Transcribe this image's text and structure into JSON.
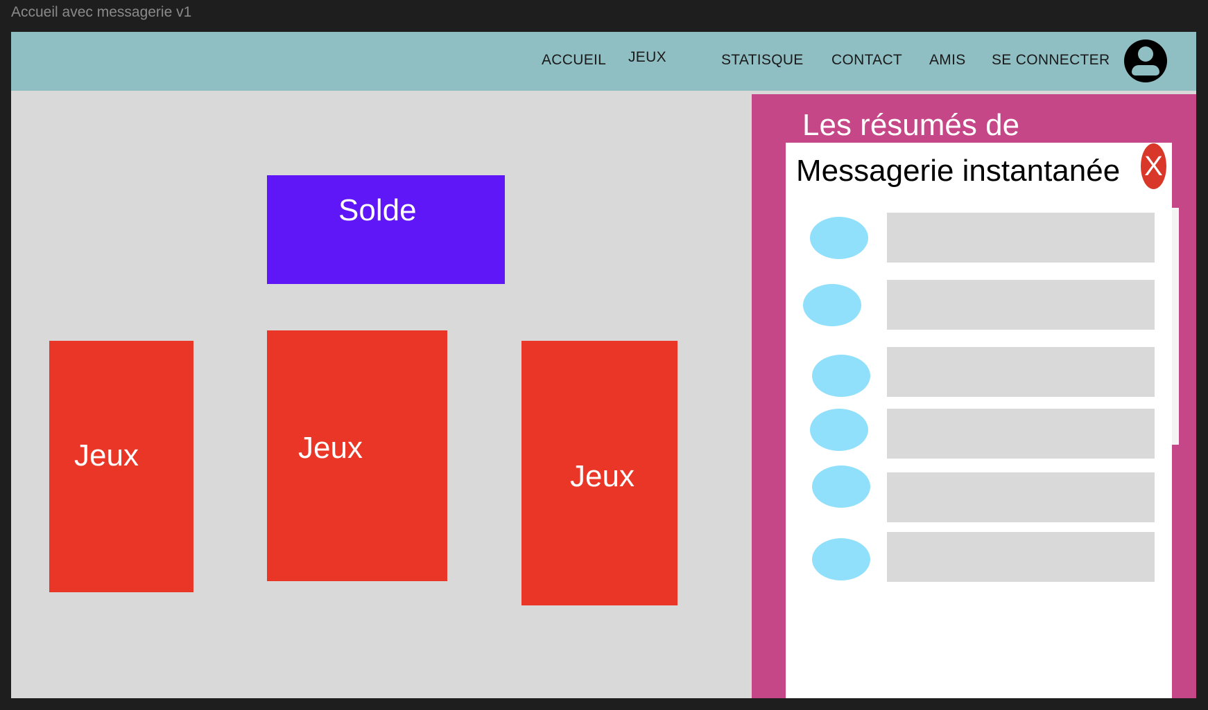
{
  "frame": {
    "title": "Accueil avec messagerie v1"
  },
  "nav": {
    "items": [
      "ACCUEIL",
      "JEUX",
      "STATISQUE",
      "CONTACT",
      "AMIS",
      "SE CONNECTER"
    ],
    "avatar_icon": "user-circle-icon",
    "background": "#8fbec3"
  },
  "main": {
    "solde_label": "Solde",
    "games": [
      "Jeux",
      "Jeux",
      "Jeux"
    ],
    "colors": {
      "solde": "#5f17f7",
      "games": "#e93627",
      "background": "#d9d9d9"
    }
  },
  "sidebar": {
    "title": "Les résumés de",
    "background": "#c64788",
    "chat": {
      "title": "Messagerie instantanée",
      "close_label": "X",
      "messages_count_shown": 6,
      "avatar_color": "#90e0fc"
    }
  }
}
